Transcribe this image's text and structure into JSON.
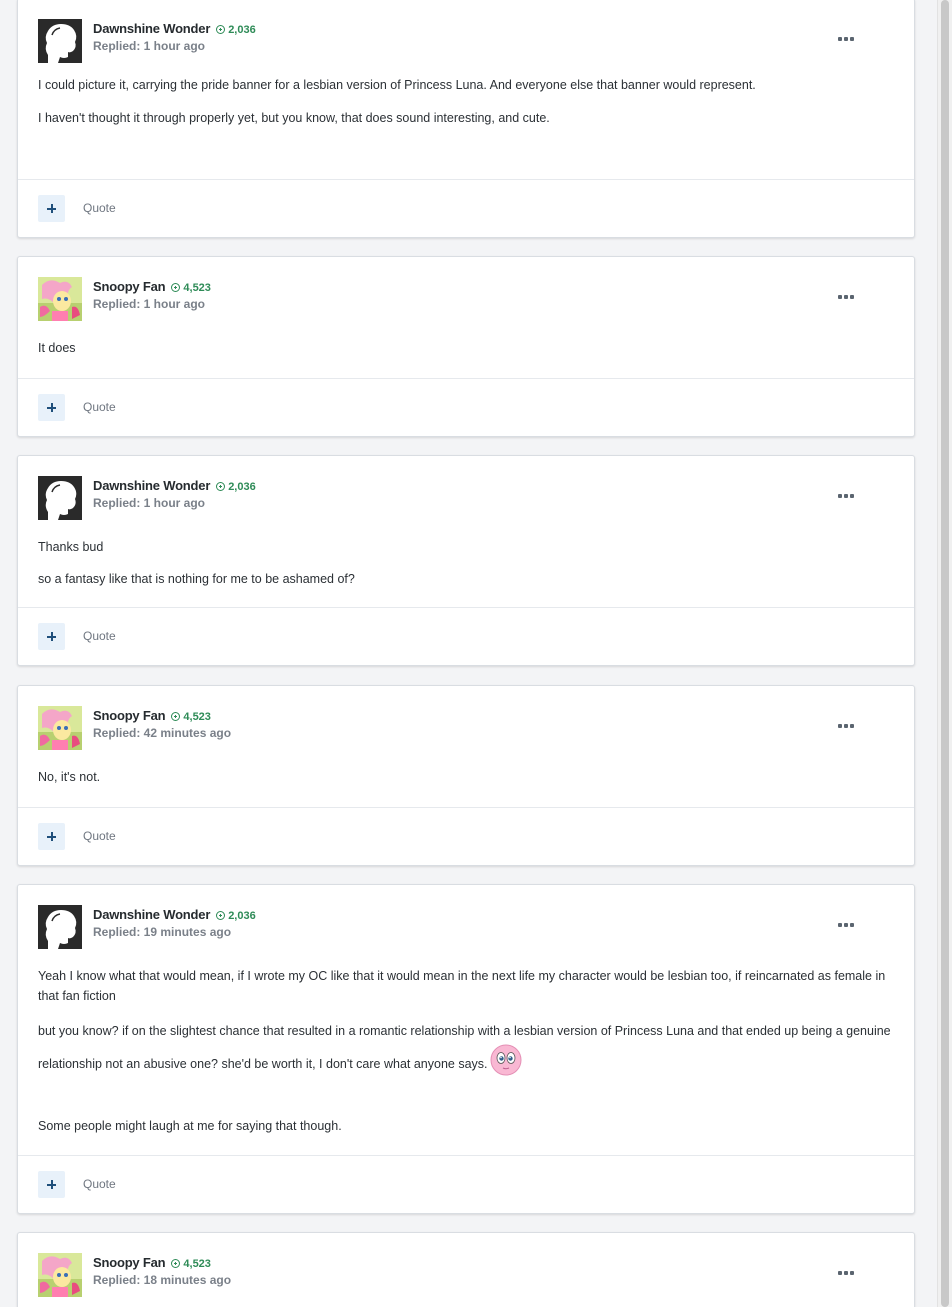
{
  "users": {
    "dawnshine": {
      "name": "Dawnshine Wonder",
      "rep": "2,036"
    },
    "snoopy": {
      "name": "Snoopy Fan",
      "rep": "4,523"
    }
  },
  "ui": {
    "quote_label": "Quote",
    "more_icon": "ellipsis-icon",
    "like_icon": "plus-icon",
    "rep_icon": "plus-circle-icon",
    "rep_color": "#2e8b57"
  },
  "posts": [
    {
      "author": "Dawnshine Wonder",
      "rep": "2,036",
      "meta": "Replied: 1 hour ago",
      "paragraphs": [
        "I could picture it, carrying the pride banner for a lesbian version of Princess Luna. And everyone else that banner would represent.",
        "I haven't thought it through properly yet, but you know, that does sound interesting, and cute."
      ]
    },
    {
      "author": "Snoopy Fan",
      "rep": "4,523",
      "meta": "Replied: 1 hour ago",
      "paragraphs": [
        "It does"
      ]
    },
    {
      "author": "Dawnshine Wonder",
      "rep": "2,036",
      "meta": "Replied: 1 hour ago",
      "paragraphs": [
        "Thanks bud",
        "so a fantasy like that is nothing for me to be ashamed of?"
      ]
    },
    {
      "author": "Snoopy Fan",
      "rep": "4,523",
      "meta": "Replied: 42 minutes ago",
      "paragraphs": [
        "No, it's not."
      ]
    },
    {
      "author": "Dawnshine Wonder",
      "rep": "2,036",
      "meta": "Replied: 19 minutes ago",
      "paragraphs": [
        "Yeah I know what that would mean, if I wrote my OC like that it would mean in the next life my character would be lesbian too, if reincarnated as female in that fan fiction",
        "but you know? if on the slightest chance that resulted in a romantic relationship with a lesbian version of Princess Luna and that ended up being a genuine relationship not an abusive one? she'd be worth it, I don't care what anyone says.",
        "Some people might laugh at me for saying that though."
      ],
      "emoji": "pony-face-emoji"
    },
    {
      "author": "Snoopy Fan",
      "rep": "4,523",
      "meta": "Replied: 18 minutes ago",
      "paragraphs": []
    }
  ]
}
